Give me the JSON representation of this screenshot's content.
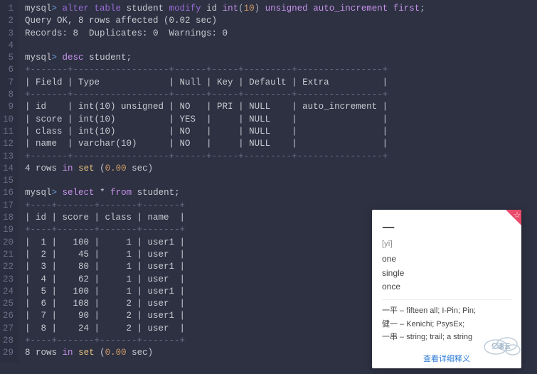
{
  "lines": [
    {
      "n": 1,
      "parts": [
        {
          "t": "mysql",
          "c": "prompt"
        },
        {
          "t": "> ",
          "c": "arrow"
        },
        {
          "t": "alter table",
          "c": "kw-alter"
        },
        {
          "t": " student ",
          "c": ""
        },
        {
          "t": "modify",
          "c": "kw-modify"
        },
        {
          "t": " id ",
          "c": ""
        },
        {
          "t": "int",
          "c": "kw-type"
        },
        {
          "t": "(",
          "c": "punct"
        },
        {
          "t": "10",
          "c": "kw-num"
        },
        {
          "t": ") ",
          "c": "punct"
        },
        {
          "t": "unsigned",
          "c": "kw-type"
        },
        {
          "t": " ",
          "c": ""
        },
        {
          "t": "auto_increment",
          "c": "kw-type"
        },
        {
          "t": " ",
          "c": ""
        },
        {
          "t": "first",
          "c": "kw-first"
        },
        {
          "t": ";",
          "c": "punct"
        }
      ]
    },
    {
      "n": 2,
      "parts": [
        {
          "t": "Query OK, 8 rows affected (0.02 sec)",
          "c": ""
        }
      ]
    },
    {
      "n": 3,
      "parts": [
        {
          "t": "Records: 8  Duplicates: 0  Warnings: 0",
          "c": ""
        }
      ]
    },
    {
      "n": 4,
      "parts": [
        {
          "t": "",
          "c": ""
        }
      ]
    },
    {
      "n": 5,
      "parts": [
        {
          "t": "mysql",
          "c": "prompt"
        },
        {
          "t": "> ",
          "c": "arrow"
        },
        {
          "t": "desc",
          "c": "kw-desc"
        },
        {
          "t": " student;",
          "c": ""
        }
      ]
    },
    {
      "n": 6,
      "parts": [
        {
          "t": "+-------+------------------+------+-----+---------+----------------+",
          "c": "dim"
        }
      ]
    },
    {
      "n": 7,
      "parts": [
        {
          "t": "| Field | Type             | Null | Key | Default | Extra          |",
          "c": ""
        }
      ]
    },
    {
      "n": 8,
      "parts": [
        {
          "t": "+-------+------------------+------+-----+---------+----------------+",
          "c": "dim"
        }
      ]
    },
    {
      "n": 9,
      "parts": [
        {
          "t": "| id    | int(10) unsigned | NO   | PRI | NULL    | auto_increment |",
          "c": ""
        }
      ]
    },
    {
      "n": 10,
      "parts": [
        {
          "t": "| score | int(10)          | YES  |     | NULL    |                |",
          "c": ""
        }
      ]
    },
    {
      "n": 11,
      "parts": [
        {
          "t": "| class | int(10)          | NO   |     | NULL    |                |",
          "c": ""
        }
      ]
    },
    {
      "n": 12,
      "parts": [
        {
          "t": "| name  | varchar(10)      | NO   |     | NULL    |                |",
          "c": ""
        }
      ]
    },
    {
      "n": 13,
      "parts": [
        {
          "t": "+-------+------------------+------+-----+---------+----------------+",
          "c": "dim"
        }
      ]
    },
    {
      "n": 14,
      "parts": [
        {
          "t": "4 rows ",
          "c": ""
        },
        {
          "t": "in",
          "c": "kw-in"
        },
        {
          "t": " ",
          "c": ""
        },
        {
          "t": "set",
          "c": "kw-set"
        },
        {
          "t": " (",
          "c": ""
        },
        {
          "t": "0.00",
          "c": "kw-time"
        },
        {
          "t": " sec)",
          "c": ""
        }
      ]
    },
    {
      "n": 15,
      "parts": [
        {
          "t": "",
          "c": ""
        }
      ]
    },
    {
      "n": 16,
      "parts": [
        {
          "t": "mysql",
          "c": "prompt"
        },
        {
          "t": "> ",
          "c": "arrow"
        },
        {
          "t": "select",
          "c": "kw-select"
        },
        {
          "t": " * ",
          "c": ""
        },
        {
          "t": "from",
          "c": "kw-from"
        },
        {
          "t": " student;",
          "c": ""
        }
      ]
    },
    {
      "n": 17,
      "parts": [
        {
          "t": "+----+-------+-------+-------+",
          "c": "dim"
        }
      ]
    },
    {
      "n": 18,
      "parts": [
        {
          "t": "| id | score | class | name  |",
          "c": ""
        }
      ]
    },
    {
      "n": 19,
      "parts": [
        {
          "t": "+----+-------+-------+-------+",
          "c": "dim"
        }
      ]
    },
    {
      "n": 20,
      "parts": [
        {
          "t": "|  1 |   100 |     1 | user1 |",
          "c": ""
        }
      ]
    },
    {
      "n": 21,
      "parts": [
        {
          "t": "|  2 |    45 |     1 | user  |",
          "c": ""
        }
      ]
    },
    {
      "n": 22,
      "parts": [
        {
          "t": "|  3 |    80 |     1 | user1 |",
          "c": ""
        }
      ]
    },
    {
      "n": 23,
      "parts": [
        {
          "t": "|  4 |    62 |     1 | user  |",
          "c": ""
        }
      ]
    },
    {
      "n": 24,
      "parts": [
        {
          "t": "|  5 |   100 |     1 | user1 |",
          "c": ""
        }
      ]
    },
    {
      "n": 25,
      "parts": [
        {
          "t": "|  6 |   108 |     2 | user  |",
          "c": ""
        }
      ]
    },
    {
      "n": 26,
      "parts": [
        {
          "t": "|  7 |    90 |     2 | user1 |",
          "c": ""
        }
      ]
    },
    {
      "n": 27,
      "parts": [
        {
          "t": "|  8 |    24 |     2 | user  |",
          "c": ""
        }
      ]
    },
    {
      "n": 28,
      "parts": [
        {
          "t": "+----+-------+-------+-------+",
          "c": "dim"
        }
      ]
    },
    {
      "n": 29,
      "parts": [
        {
          "t": "8 rows ",
          "c": ""
        },
        {
          "t": "in",
          "c": "kw-in"
        },
        {
          "t": " ",
          "c": ""
        },
        {
          "t": "set",
          "c": "kw-set"
        },
        {
          "t": " (",
          "c": ""
        },
        {
          "t": "0.00",
          "c": "kw-time"
        },
        {
          "t": " sec)",
          "c": ""
        }
      ]
    }
  ],
  "desc_table": {
    "columns": [
      "Field",
      "Type",
      "Null",
      "Key",
      "Default",
      "Extra"
    ],
    "rows": [
      [
        "id",
        "int(10) unsigned",
        "NO",
        "PRI",
        "NULL",
        "auto_increment"
      ],
      [
        "score",
        "int(10)",
        "YES",
        "",
        "NULL",
        ""
      ],
      [
        "class",
        "int(10)",
        "NO",
        "",
        "NULL",
        ""
      ],
      [
        "name",
        "varchar(10)",
        "NO",
        "",
        "NULL",
        ""
      ]
    ]
  },
  "chart_data": {
    "type": "table",
    "title": "select * from student",
    "columns": [
      "id",
      "score",
      "class",
      "name"
    ],
    "rows": [
      [
        1,
        100,
        1,
        "user1"
      ],
      [
        2,
        45,
        1,
        "user"
      ],
      [
        3,
        80,
        1,
        "user1"
      ],
      [
        4,
        62,
        1,
        "user"
      ],
      [
        5,
        100,
        1,
        "user1"
      ],
      [
        6,
        108,
        2,
        "user"
      ],
      [
        7,
        90,
        2,
        "user1"
      ],
      [
        8,
        24,
        2,
        "user"
      ]
    ]
  },
  "dict": {
    "headword": "一",
    "pron": "[yī]",
    "definitions": [
      "one",
      "single",
      "once"
    ],
    "compounds": [
      "一平 – fifteen all; I-Pin; Pin;",
      "健一 – Kenichi; PsysEx;",
      "一串 – string; trail; a string"
    ],
    "link": "查看详细释义"
  },
  "watermark": "亿速云"
}
